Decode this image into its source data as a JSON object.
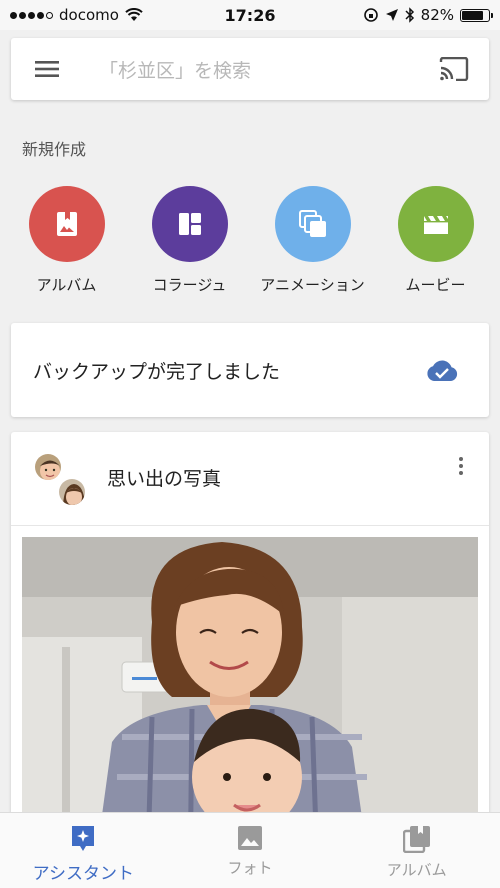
{
  "status_bar": {
    "carrier": "docomo",
    "time": "17:26",
    "battery": "82%",
    "battery_level": 0.82
  },
  "search": {
    "placeholder": "「杉並区」を検索"
  },
  "create": {
    "title": "新規作成",
    "items": [
      {
        "label": "アルバム",
        "color": "#d8534f",
        "icon": "album-icon"
      },
      {
        "label": "コラージュ",
        "color": "#5c3d9c",
        "icon": "collage-icon"
      },
      {
        "label": "アニメーション",
        "color": "#6fb0ea",
        "icon": "animation-icon"
      },
      {
        "label": "ムービー",
        "color": "#7fb23f",
        "icon": "movie-icon"
      }
    ]
  },
  "backup": {
    "message": "バックアップが完了しました",
    "icon_color": "#4a72b8"
  },
  "memories": {
    "title": "思い出の写真"
  },
  "bottom_nav": {
    "items": [
      {
        "label": "アシスタント",
        "icon": "assistant-icon",
        "active": true
      },
      {
        "label": "フォト",
        "icon": "photos-icon",
        "active": false
      },
      {
        "label": "アルバム",
        "icon": "albums-icon",
        "active": false
      }
    ],
    "active_color": "#3f6cc4"
  }
}
